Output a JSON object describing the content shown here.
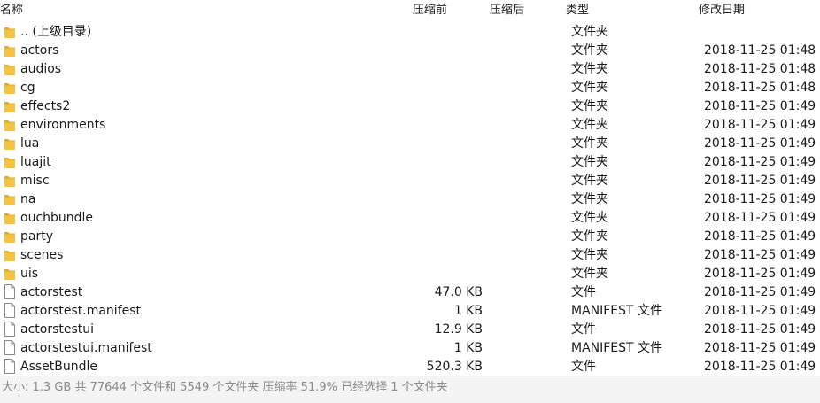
{
  "header": {
    "name": "名称",
    "original_size": "压缩前",
    "compressed_size": "压缩后",
    "type": "类型",
    "modified": "修改日期"
  },
  "rows": [
    {
      "icon": "folder-icon",
      "name": ".. (上级目录)",
      "size": "",
      "type": "文件夹",
      "date": ""
    },
    {
      "icon": "folder-icon",
      "name": "actors",
      "size": "",
      "type": "文件夹",
      "date": "2018-11-25 01:48"
    },
    {
      "icon": "folder-icon",
      "name": "audios",
      "size": "",
      "type": "文件夹",
      "date": "2018-11-25 01:48"
    },
    {
      "icon": "folder-icon",
      "name": "cg",
      "size": "",
      "type": "文件夹",
      "date": "2018-11-25 01:48"
    },
    {
      "icon": "folder-icon",
      "name": "effects2",
      "size": "",
      "type": "文件夹",
      "date": "2018-11-25 01:49"
    },
    {
      "icon": "folder-icon",
      "name": "environments",
      "size": "",
      "type": "文件夹",
      "date": "2018-11-25 01:49"
    },
    {
      "icon": "folder-icon",
      "name": "lua",
      "size": "",
      "type": "文件夹",
      "date": "2018-11-25 01:49"
    },
    {
      "icon": "folder-icon",
      "name": "luajit",
      "size": "",
      "type": "文件夹",
      "date": "2018-11-25 01:49"
    },
    {
      "icon": "folder-icon",
      "name": "misc",
      "size": "",
      "type": "文件夹",
      "date": "2018-11-25 01:49"
    },
    {
      "icon": "folder-icon",
      "name": "na",
      "size": "",
      "type": "文件夹",
      "date": "2018-11-25 01:49"
    },
    {
      "icon": "folder-icon",
      "name": "ouchbundle",
      "size": "",
      "type": "文件夹",
      "date": "2018-11-25 01:49"
    },
    {
      "icon": "folder-icon",
      "name": "party",
      "size": "",
      "type": "文件夹",
      "date": "2018-11-25 01:49"
    },
    {
      "icon": "folder-icon",
      "name": "scenes",
      "size": "",
      "type": "文件夹",
      "date": "2018-11-25 01:49"
    },
    {
      "icon": "folder-icon",
      "name": "uis",
      "size": "",
      "type": "文件夹",
      "date": "2018-11-25 01:49"
    },
    {
      "icon": "file-icon",
      "name": "actorstest",
      "size": "47.0 KB",
      "type": "文件",
      "date": "2018-11-25 01:49"
    },
    {
      "icon": "file-icon",
      "name": "actorstest.manifest",
      "size": "1 KB",
      "type": "MANIFEST 文件",
      "date": "2018-11-25 01:49"
    },
    {
      "icon": "file-icon",
      "name": "actorstestui",
      "size": "12.9 KB",
      "type": "文件",
      "date": "2018-11-25 01:49"
    },
    {
      "icon": "file-icon",
      "name": "actorstestui.manifest",
      "size": "1 KB",
      "type": "MANIFEST 文件",
      "date": "2018-11-25 01:49"
    },
    {
      "icon": "file-icon",
      "name": "AssetBundle",
      "size": "520.3 KB",
      "type": "文件",
      "date": "2018-11-25 01:49"
    }
  ],
  "status": {
    "text": "大小: 1.3 GB 共 77644 个文件和 5549 个文件夹 压缩率 51.9% 已经选择 1 个文件夹"
  },
  "colors": {
    "folder": "#F5C342",
    "folder_dark": "#E0A92A",
    "file_border": "#8a8a8a"
  }
}
